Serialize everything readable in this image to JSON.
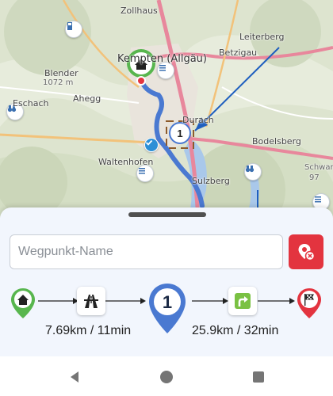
{
  "map": {
    "labels": {
      "zollhaus": "Zollhaus",
      "kempten": "Kempten (Allgäu)",
      "leiterberg": "Leiterberg",
      "betzigau": "Betzigau",
      "blender": "Blender",
      "blender_alt": "1072 m",
      "ahegg": "Ahegg",
      "eschach": "Eschach",
      "durach": "Durach",
      "bodelsberg": "Bodelsberg",
      "waltenhofen": "Waltenhofen",
      "sulzberg": "Sulzberg",
      "schwarz": "Schwarz",
      "schwarz_alt": "97"
    },
    "waypoint_number": "1",
    "colors": {
      "route": "#4a79d1",
      "motorway": "#e8879c",
      "water": "#a9c8ea"
    }
  },
  "panel": {
    "waypoint_name_placeholder": "Wegpunkt-Name",
    "remove_waypoint_icon": "marker-remove-icon",
    "timeline": {
      "start_icon": "home-icon",
      "highway_icon": "highway-icon",
      "waypoint_number": "1",
      "turn_icon": "turn-right-icon",
      "end_icon": "finish-flag-icon",
      "segment1": "7.69km / 11min",
      "segment2": "25.9km / 32min"
    },
    "colors": {
      "start": "#58b64e",
      "waypoint": "#4a79d1",
      "end": "#e3343f",
      "turn": "#7ac143"
    }
  },
  "navbar": {
    "back_icon": "back-icon",
    "home_icon": "home-circle-icon",
    "recents_icon": "recents-icon"
  }
}
